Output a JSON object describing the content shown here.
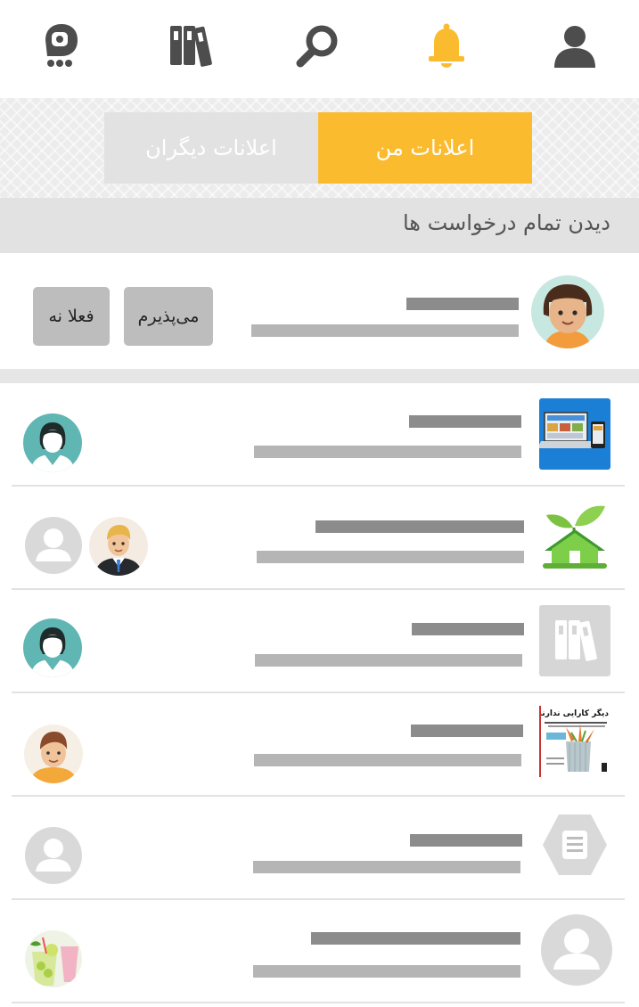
{
  "nav": {
    "items": [
      {
        "icon": "profile-icon"
      },
      {
        "icon": "notifications-icon",
        "active": true
      },
      {
        "icon": "search-icon"
      },
      {
        "icon": "library-icon"
      },
      {
        "icon": "tape-icon"
      }
    ],
    "active_color": "#fbbb2e",
    "inactive_color": "#4d4d4d"
  },
  "tabs": {
    "mine": "اعلانات من",
    "others": "اعلانات دیگران"
  },
  "all_requests_label": "دیدن تمام درخواست ها",
  "request": {
    "accept_label": "می‌پذیرم",
    "decline_label": "فعلا نه"
  },
  "notifications": [
    {
      "thumb": "laptop-image",
      "avatars": [
        "female-user-avatar"
      ]
    },
    {
      "thumb": "green-house-image",
      "avatars": [
        "businessman-avatar",
        "default-user-avatar"
      ]
    },
    {
      "thumb": "library-icon",
      "avatars": [
        "female-user-avatar"
      ]
    },
    {
      "thumb": "book-cover-image",
      "book_title": "دیگر کارایی ندارند",
      "avatars": [
        "male-user-avatar"
      ]
    },
    {
      "thumb": "document-hexagon-icon",
      "avatars": [
        "default-user-avatar"
      ]
    },
    {
      "thumb": "default-user-avatar",
      "avatars": [
        "drinks-photo-avatar"
      ]
    }
  ]
}
